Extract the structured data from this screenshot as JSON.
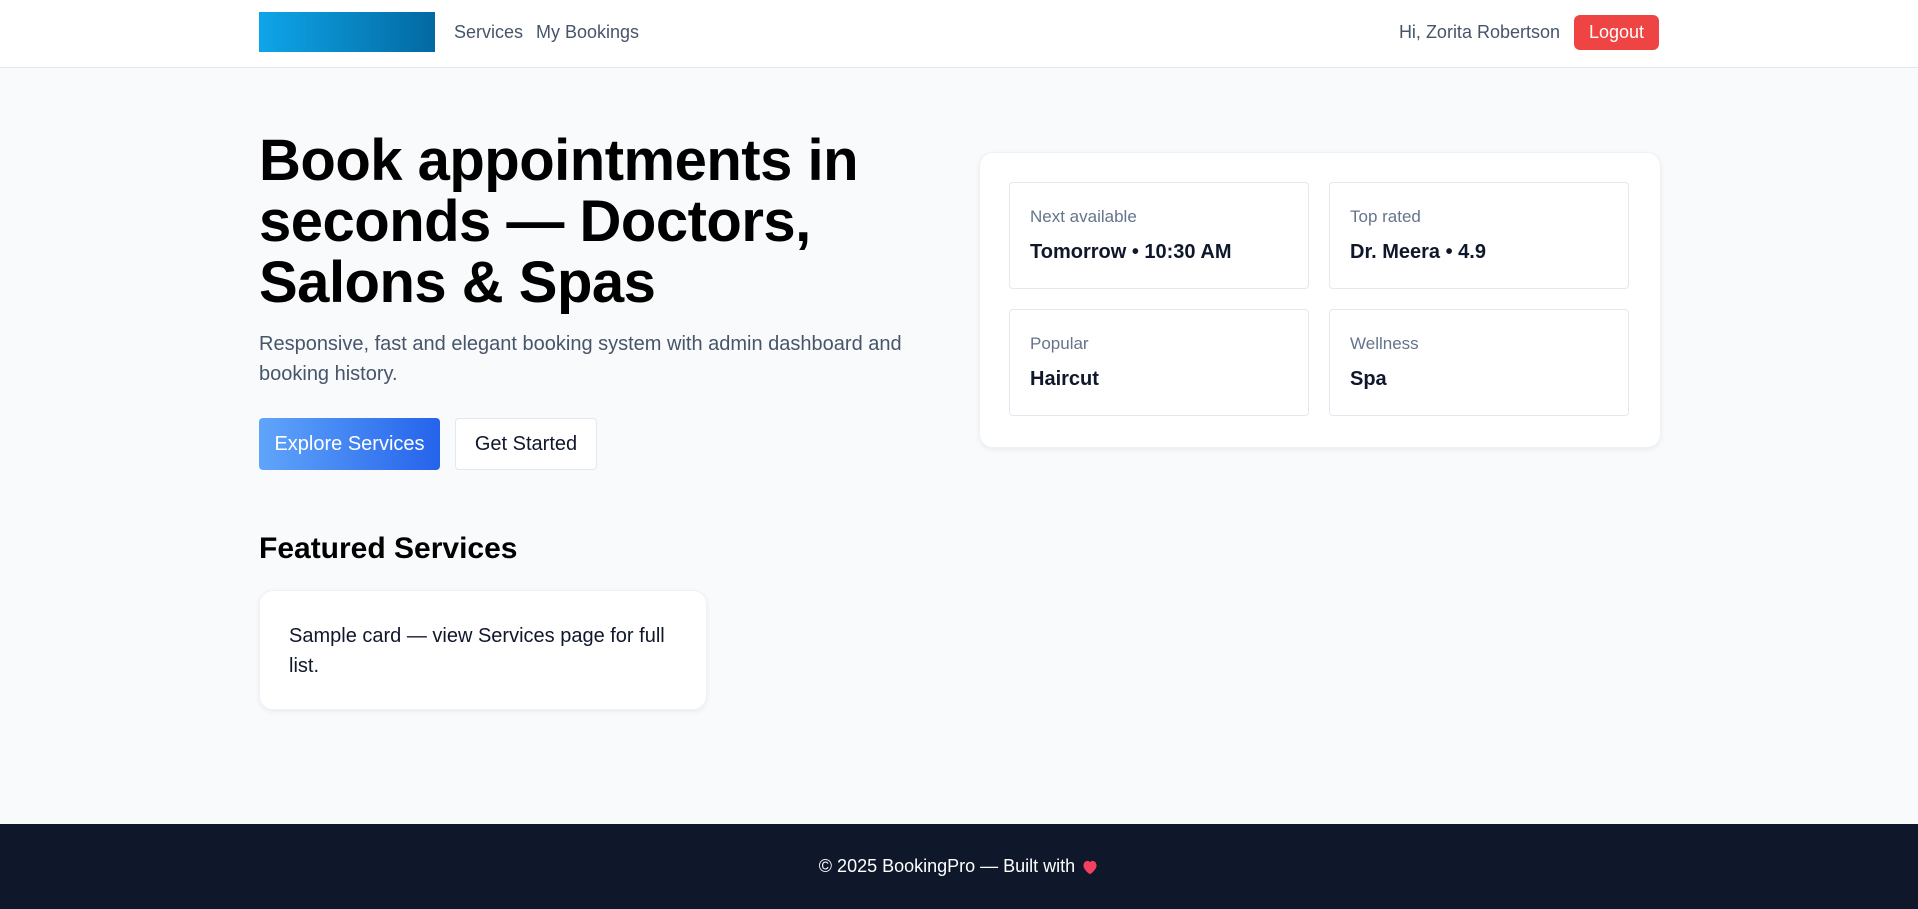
{
  "header": {
    "nav": {
      "services": "Services",
      "my_bookings": "My Bookings"
    },
    "greeting": "Hi, Zorita Robertson",
    "logout_label": "Logout",
    "logo_gradient": [
      "#0ea5e9",
      "#0369a1"
    ]
  },
  "hero": {
    "title": "Book appointments in seconds — Doctors, Salons & Spas",
    "subtitle": "Responsive, fast and elegant booking system with admin dashboard and booking history.",
    "primary_button": "Explore Services",
    "secondary_button": "Get Started"
  },
  "stats": [
    {
      "label": "Next available",
      "value": "Tomorrow • 10:30 AM"
    },
    {
      "label": "Top rated",
      "value": "Dr. Meera • 4.9"
    },
    {
      "label": "Popular",
      "value": "Haircut"
    },
    {
      "label": "Wellness",
      "value": "Spa"
    }
  ],
  "featured": {
    "title": "Featured Services",
    "sample_card_text": "Sample card — view Services page for full list."
  },
  "footer": {
    "text": "© 2025 BookingPro — Built with",
    "icon": "heart-icon"
  },
  "colors": {
    "accent": "#2563eb",
    "danger": "#ef4444",
    "footer_bg": "#0f172a",
    "heart": "#f43f5e"
  }
}
